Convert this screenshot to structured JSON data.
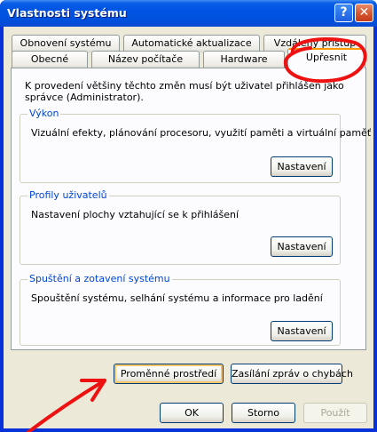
{
  "window": {
    "title": "Vlastnosti systému"
  },
  "tabs_back": [
    "Obnovení systému",
    "Automatické aktualizace",
    "Vzdálený přístup"
  ],
  "tabs_front": [
    "Obecné",
    "Název počítače",
    "Hardware",
    "Upřesnit"
  ],
  "notice": "K provedení většiny těchto změn musí být uživatel přihlášen jako správce (Administrator).",
  "groups": [
    {
      "title": "Výkon",
      "text": "Vizuální efekty, plánování procesoru, využití paměti a virtuální paměť",
      "button": "Nastavení"
    },
    {
      "title": "Profily uživatelů",
      "text": "Nastavení plochy vztahující se k přihlášení",
      "button": "Nastavení"
    },
    {
      "title": "Spuštění a zotavení systému",
      "text": "Spouštění systému, selhání systému a informace pro ladění",
      "button": "Nastavení"
    }
  ],
  "bottom_buttons": {
    "env": "Proměnné prostředí",
    "errors": "Zasílání zpráv o chybách"
  },
  "dialog_buttons": {
    "ok": "OK",
    "cancel": "Storno",
    "apply": "Použít"
  },
  "annotation_color": "#ee1111"
}
